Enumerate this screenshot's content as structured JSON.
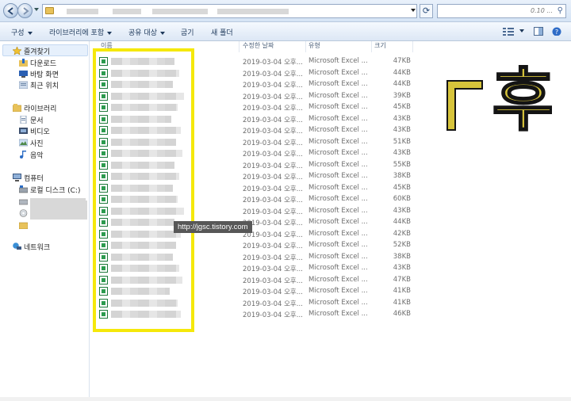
{
  "address_bar": {
    "search_placeholder": "0.10 ..."
  },
  "toolbar": {
    "organize": "구성",
    "include_library": "라이브러리에 포함",
    "share_with": "공유 대상",
    "burn": "굽기",
    "new_folder": "새 폴더"
  },
  "nav": {
    "favorites": "즐겨찾기",
    "downloads": "다운로드",
    "desktop": "바탕 화면",
    "recent": "최근 위치",
    "libraries": "라이브러리",
    "documents": "문서",
    "videos": "비디오",
    "pictures": "사진",
    "music": "음악",
    "computer": "컴퓨터",
    "local_disk": "로컬 디스크 (C:)",
    "network": "네트워크"
  },
  "columns": {
    "name": "이름",
    "date_modified": "수정한 날짜",
    "type": "유형",
    "size": "크기"
  },
  "files": [
    {
      "date": "2019-03-04 오후...",
      "type": "Microsoft Excel ...",
      "size": "47KB"
    },
    {
      "date": "2019-03-04 오후...",
      "type": "Microsoft Excel ...",
      "size": "44KB"
    },
    {
      "date": "2019-03-04 오후...",
      "type": "Microsoft Excel ...",
      "size": "44KB"
    },
    {
      "date": "2019-03-04 오후...",
      "type": "Microsoft Excel ...",
      "size": "39KB"
    },
    {
      "date": "2019-03-04 오후...",
      "type": "Microsoft Excel ...",
      "size": "45KB"
    },
    {
      "date": "2019-03-04 오후...",
      "type": "Microsoft Excel ...",
      "size": "43KB"
    },
    {
      "date": "2019-03-04 오후...",
      "type": "Microsoft Excel ...",
      "size": "43KB"
    },
    {
      "date": "2019-03-04 오후...",
      "type": "Microsoft Excel ...",
      "size": "51KB"
    },
    {
      "date": "2019-03-04 오후...",
      "type": "Microsoft Excel ...",
      "size": "43KB"
    },
    {
      "date": "2019-03-04 오후...",
      "type": "Microsoft Excel ...",
      "size": "55KB"
    },
    {
      "date": "2019-03-04 오후...",
      "type": "Microsoft Excel ...",
      "size": "38KB"
    },
    {
      "date": "2019-03-04 오후...",
      "type": "Microsoft Excel ...",
      "size": "45KB"
    },
    {
      "date": "2019-03-04 오후...",
      "type": "Microsoft Excel ...",
      "size": "60KB"
    },
    {
      "date": "2019-03-04 오후...",
      "type": "Microsoft Excel ...",
      "size": "43KB"
    },
    {
      "date": "2019-03-04 오후...",
      "type": "Microsoft Excel ...",
      "size": "44KB"
    },
    {
      "date": "2019-03-04 오후...",
      "type": "Microsoft Excel ...",
      "size": "42KB"
    },
    {
      "date": "2019-03-04 오후...",
      "type": "Microsoft Excel ...",
      "size": "52KB"
    },
    {
      "date": "2019-03-04 오후...",
      "type": "Microsoft Excel ...",
      "size": "38KB"
    },
    {
      "date": "2019-03-04 오후...",
      "type": "Microsoft Excel ...",
      "size": "43KB"
    },
    {
      "date": "2019-03-04 오후...",
      "type": "Microsoft Excel ...",
      "size": "47KB"
    },
    {
      "date": "2019-03-04 오후...",
      "type": "Microsoft Excel ...",
      "size": "41KB"
    },
    {
      "date": "2019-03-04 오후...",
      "type": "Microsoft Excel ...",
      "size": "41KB"
    },
    {
      "date": "2019-03-04 오후...",
      "type": "Microsoft Excel ...",
      "size": "46KB"
    }
  ],
  "watermark": "http://jgsc.tistory.com",
  "decoration_text": "후",
  "colors": {
    "highlight": "#f5e80a",
    "gold": "#d7c43b",
    "toolbar_text": "#1e395b"
  }
}
